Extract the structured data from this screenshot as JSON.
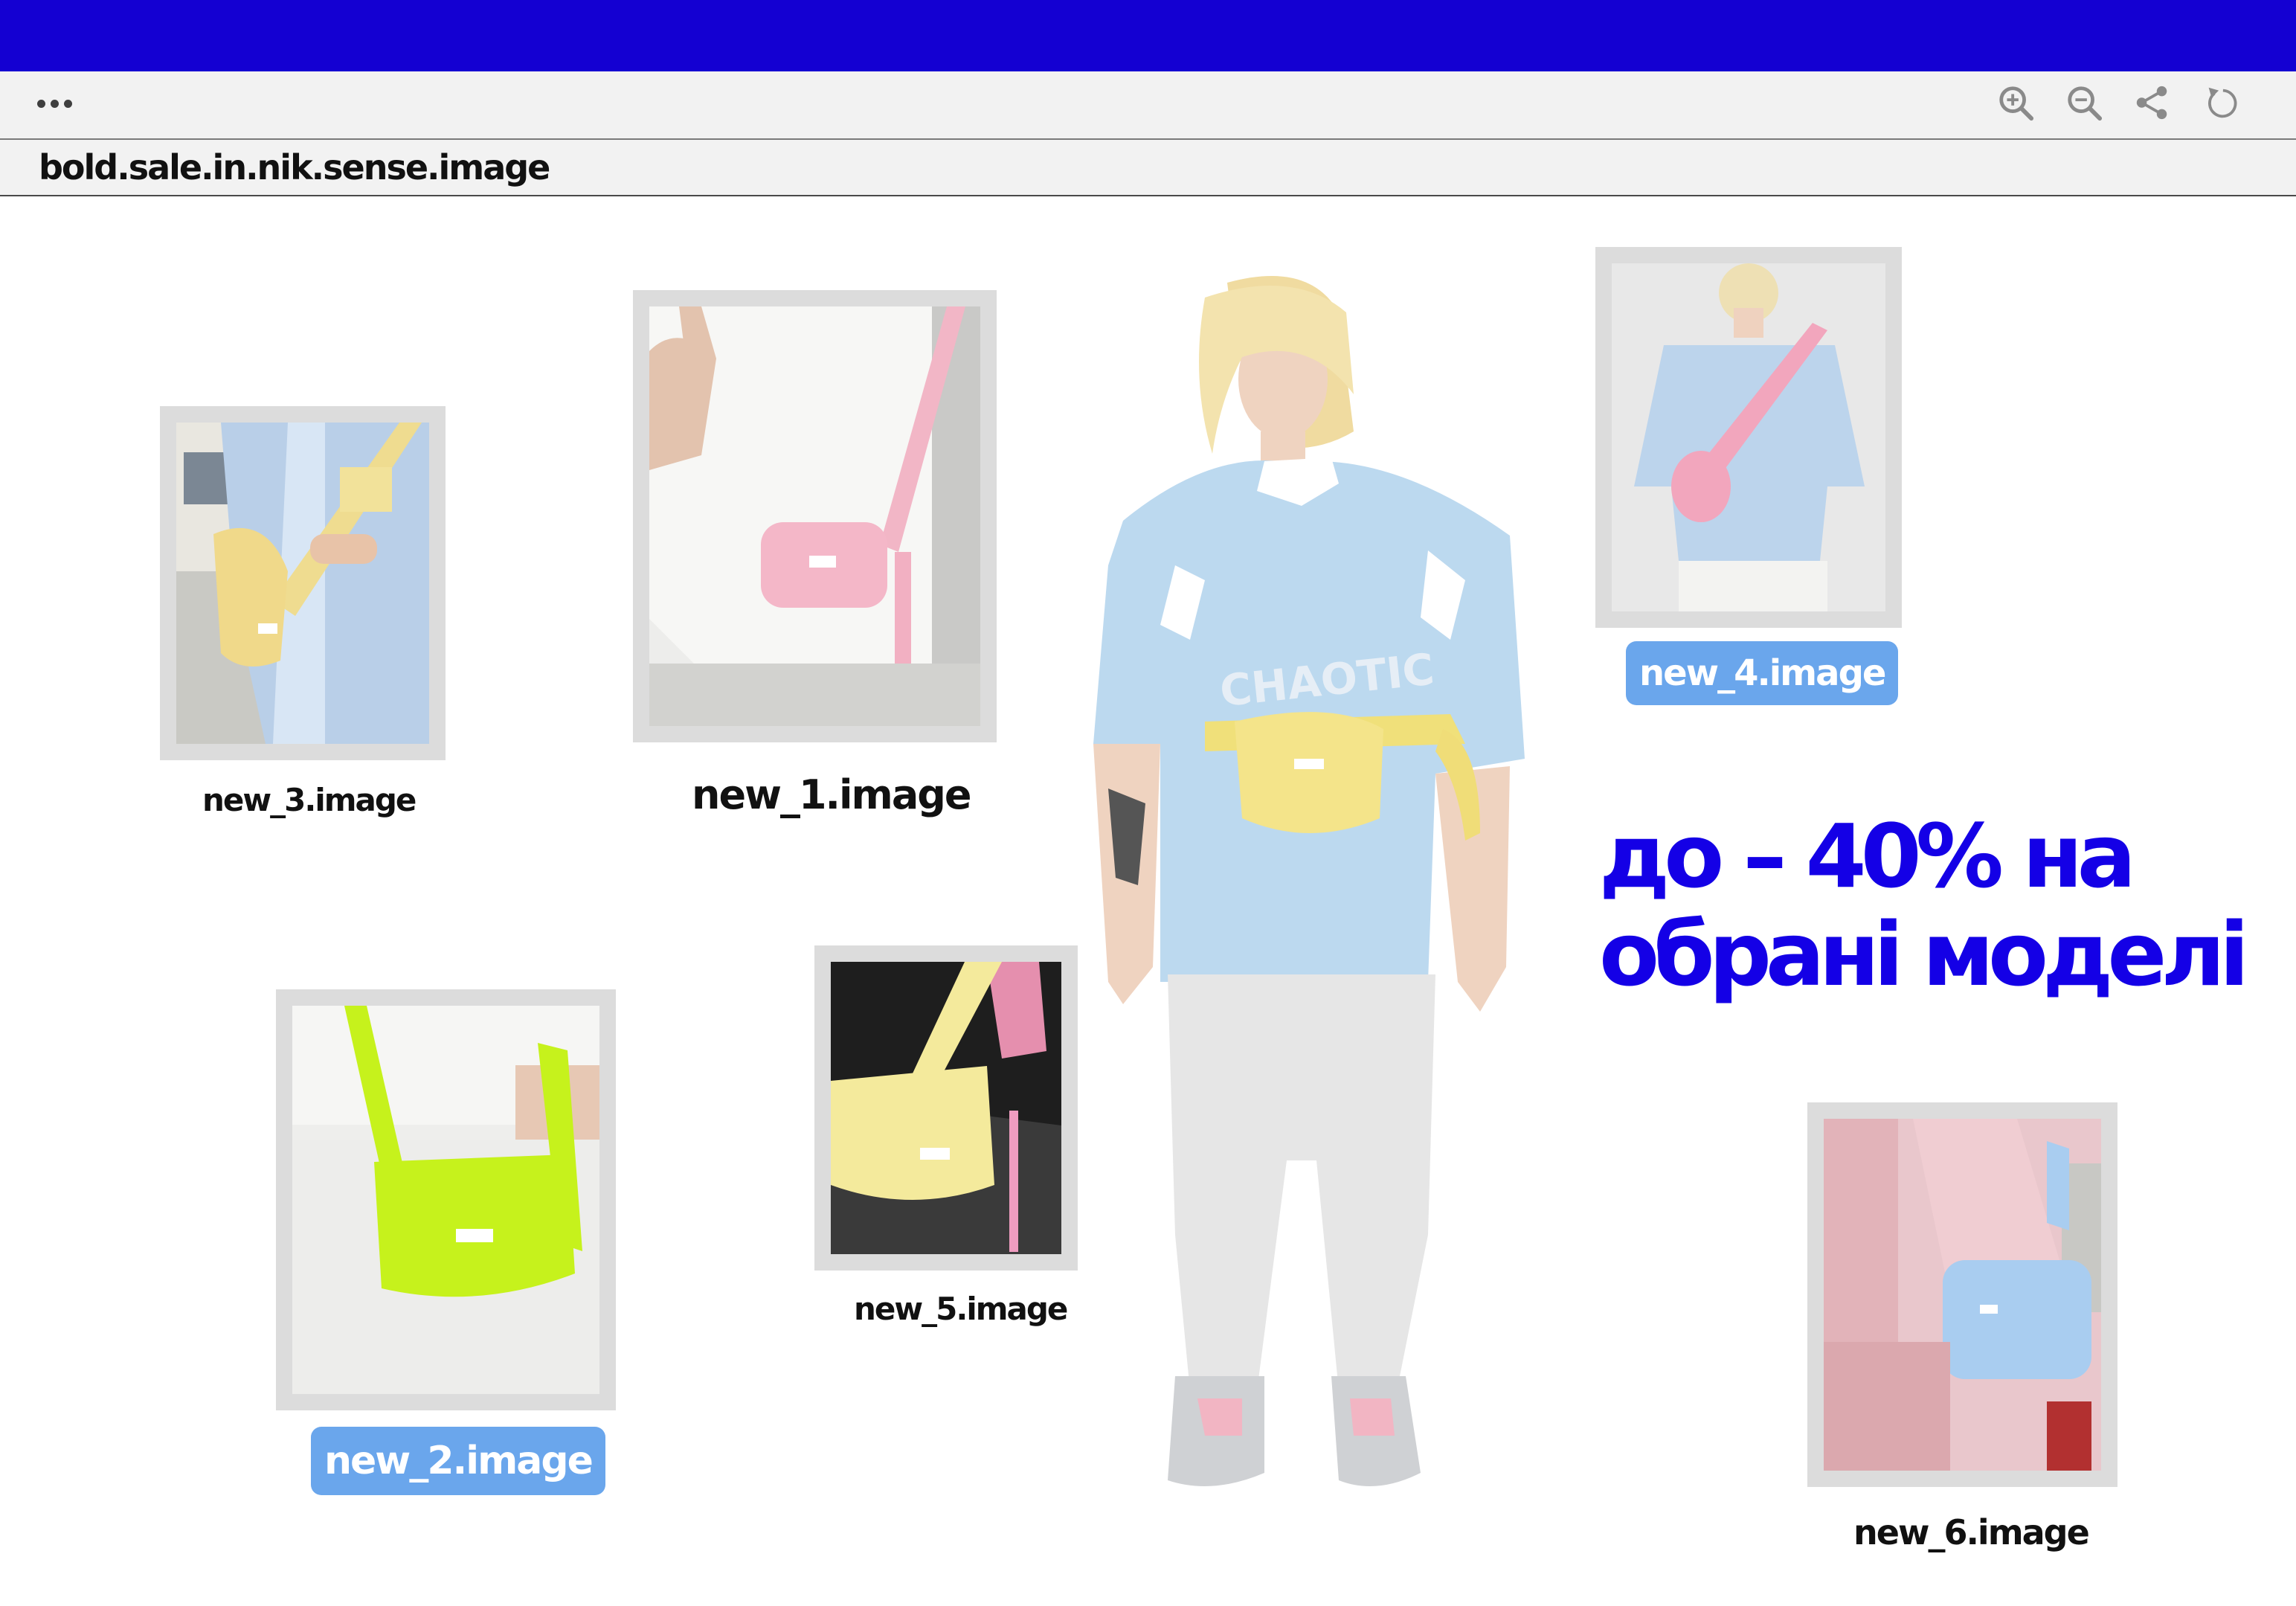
{
  "window": {
    "menu_icon": "more-dots-icon",
    "toolbar_icons": [
      "zoom-in-icon",
      "zoom-out-icon",
      "share-icon",
      "refresh-icon"
    ],
    "address": "bold.sale.in.nik.sense.image"
  },
  "gallery": [
    {
      "id": "new_3",
      "caption": "new_3.image",
      "bag_color": "#f2df8c",
      "highlighted": false
    },
    {
      "id": "new_1",
      "caption": "new_1.image",
      "bag_color": "#f4b7c8",
      "highlighted": false
    },
    {
      "id": "new_4",
      "caption": "new_4.image",
      "bag_color": "#f2a6bd",
      "highlighted": true
    },
    {
      "id": "new_2",
      "caption": "new_2.image",
      "bag_color": "#c6f21c",
      "highlighted": true
    },
    {
      "id": "new_5",
      "caption": "new_5.image",
      "bag_color": "#f4ea9c",
      "highlighted": false
    },
    {
      "id": "new_6",
      "caption": "new_6.image",
      "bag_color": "#a9cdf0",
      "highlighted": false
    }
  ],
  "promo": {
    "line1": "до – 40% на",
    "line2": "обрані моделі"
  },
  "colors": {
    "topbar": "#1400d2",
    "promo_text": "#1400e6",
    "pill": "#6aa6ec",
    "frame": "#dcdcdc"
  }
}
